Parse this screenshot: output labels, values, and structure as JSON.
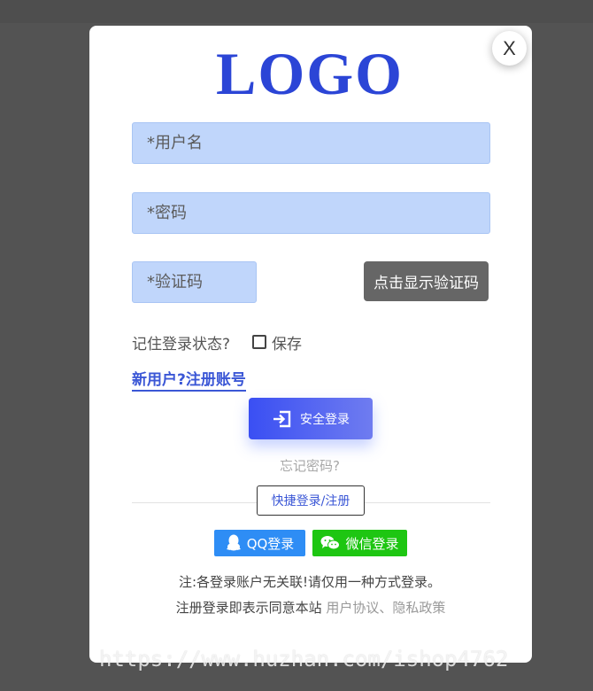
{
  "close_label": "X",
  "logo_text": "LOGO",
  "form": {
    "username_placeholder": "*用户名",
    "password_placeholder": "*密码",
    "captcha_placeholder": "*验证码",
    "captcha_button": "点击显示验证码",
    "remember_label": "记住登录状态?",
    "save_label": "保存",
    "register_link": "新用户?注册账号",
    "login_button": "安全登录",
    "forgot_link": "忘记密码?"
  },
  "quick_login_label": "快捷登录/注册",
  "social": {
    "qq_label": "QQ登录",
    "wechat_label": "微信登录"
  },
  "footer": {
    "note": "注:各登录账户无关联!请仅用一种方式登录。",
    "agree_prefix": "注册登录即表示同意本站",
    "user_agreement": "用户协议",
    "separator": "、",
    "privacy_policy": "隐私政策"
  },
  "watermark": "https://www.huzhan.com/ishop4762",
  "colors": {
    "accent": "#3b57d6",
    "qq": "#2e8df5",
    "wechat": "#1ec612",
    "field_bg": "#c0d6fb"
  }
}
